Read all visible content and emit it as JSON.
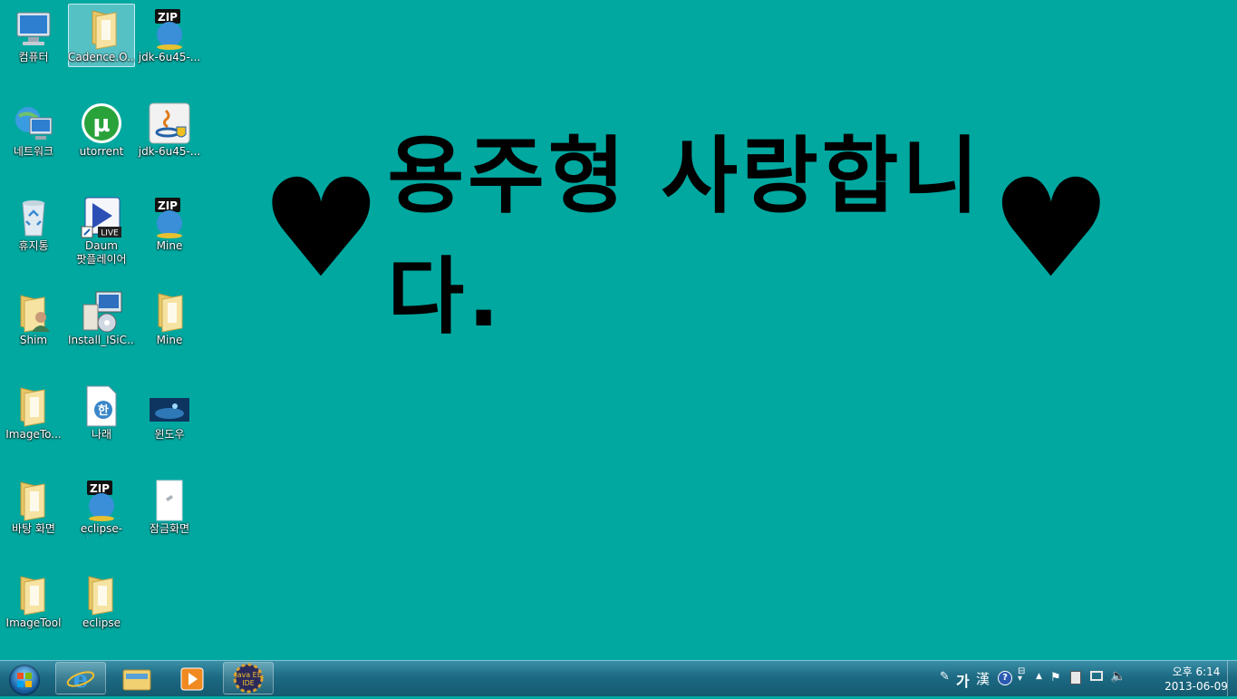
{
  "desktop": {
    "background_color": "#00a8a0",
    "wallpaper_text": {
      "heart_left": "♥",
      "message": "용주형 사랑합니다.",
      "heart_right": "♥"
    },
    "icons": [
      {
        "label": "컴퓨터",
        "icon": "computer-icon"
      },
      {
        "label": "Cadence.O...",
        "icon": "folder-icon"
      },
      {
        "label": "jdk-6u45-...",
        "icon": "zip-icon"
      },
      {
        "label": "네트워크",
        "icon": "network-icon"
      },
      {
        "label": "utorrent",
        "icon": "utorrent-icon"
      },
      {
        "label": "jdk-6u45-...",
        "icon": "java-installer-icon"
      },
      {
        "label": "휴지통",
        "icon": "recycle-bin-icon"
      },
      {
        "label": "Daum\n팟플레이어",
        "icon": "potplayer-icon"
      },
      {
        "label": "Mine",
        "icon": "zip-icon"
      },
      {
        "label": "Shim",
        "icon": "user-folder-icon"
      },
      {
        "label": "Install_ISiC...",
        "icon": "installer-icon"
      },
      {
        "label": "Mine",
        "icon": "folder-icon"
      },
      {
        "label": "ImageTo...",
        "icon": "folder-icon"
      },
      {
        "label": "나래",
        "icon": "hwp-document-icon"
      },
      {
        "label": "윈도우",
        "icon": "image-thumbnail-icon"
      },
      {
        "label": "바탕 화면",
        "icon": "folder-icon"
      },
      {
        "label": "eclipse-jee-...",
        "icon": "zip-icon"
      },
      {
        "label": "잠금화면",
        "icon": "file-icon"
      },
      {
        "label": "ImageTool",
        "icon": "folder-icon"
      },
      {
        "label": "eclipse",
        "icon": "folder-icon"
      }
    ]
  },
  "taskbar": {
    "start_label": "Start",
    "pinned": [
      {
        "name": "internet-explorer",
        "icon": "ie-icon"
      },
      {
        "name": "explorer",
        "icon": "folder-icon"
      },
      {
        "name": "media-player",
        "icon": "media-player-icon"
      },
      {
        "name": "java-ee-ide",
        "icon": "java-ee-ide-icon",
        "text": "Java EE IDE"
      }
    ],
    "tray": {
      "ime_lang": "가",
      "ime_hanja": "漢",
      "help": "?",
      "clock_time": "오후 6:14",
      "clock_date": "2013-06-09"
    }
  }
}
